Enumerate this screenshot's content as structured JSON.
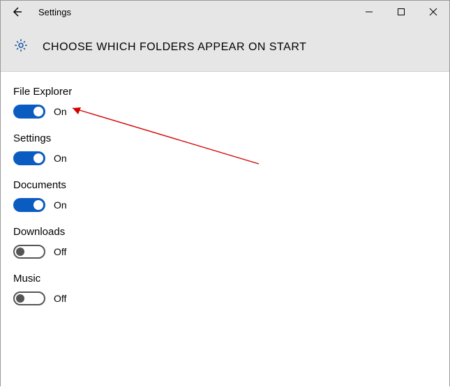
{
  "window": {
    "title": "Settings"
  },
  "page": {
    "heading": "CHOOSE WHICH FOLDERS APPEAR ON START"
  },
  "states": {
    "on": "On",
    "off": "Off"
  },
  "options": [
    {
      "label": "File Explorer",
      "enabled": true
    },
    {
      "label": "Settings",
      "enabled": true
    },
    {
      "label": "Documents",
      "enabled": true
    },
    {
      "label": "Downloads",
      "enabled": false
    },
    {
      "label": "Music",
      "enabled": false
    }
  ]
}
